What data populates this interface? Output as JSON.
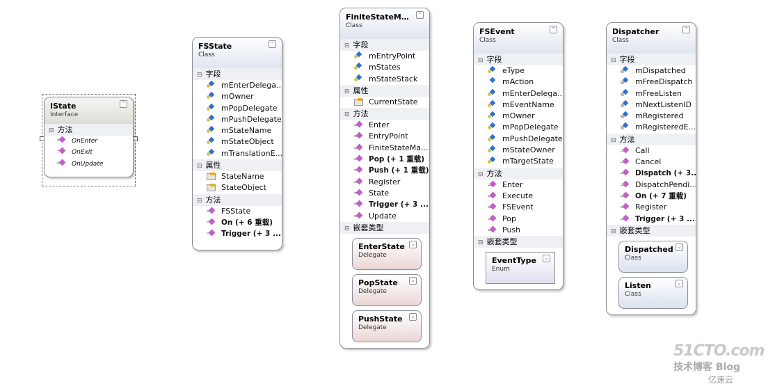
{
  "classes": [
    {
      "id": "istate",
      "title": "IState",
      "subtitle": "Interface",
      "sections": [
        {
          "label": "方法",
          "items": [
            {
              "text": "OnEnter",
              "icon": "method",
              "italic": true
            },
            {
              "text": "OnExit",
              "icon": "method",
              "italic": true
            },
            {
              "text": "OnUpdate",
              "icon": "method",
              "italic": true
            }
          ]
        }
      ]
    },
    {
      "id": "fsstate",
      "title": "FSState",
      "subtitle": "Class",
      "sections": [
        {
          "label": "字段",
          "items": [
            {
              "text": "mEnterDelega...",
              "icon": "field"
            },
            {
              "text": "mOwner",
              "icon": "field"
            },
            {
              "text": "mPopDelegate",
              "icon": "field"
            },
            {
              "text": "mPushDelegate",
              "icon": "field"
            },
            {
              "text": "mStateName",
              "icon": "field"
            },
            {
              "text": "mStateObject",
              "icon": "field"
            },
            {
              "text": "mTranslationE...",
              "icon": "field"
            }
          ]
        },
        {
          "label": "属性",
          "items": [
            {
              "text": "StateName",
              "icon": "prop"
            },
            {
              "text": "StateObject",
              "icon": "prop"
            }
          ]
        },
        {
          "label": "方法",
          "items": [
            {
              "text": "FSState",
              "icon": "method"
            },
            {
              "text": "On (+ 6 重载)",
              "icon": "method",
              "bold": true
            },
            {
              "text": "Trigger (+ 3 ...",
              "icon": "method",
              "bold": true
            }
          ]
        }
      ]
    },
    {
      "id": "fsm",
      "title": "FiniteStateMac...",
      "subtitle": "Class",
      "sections": [
        {
          "label": "字段",
          "items": [
            {
              "text": "mEntryPoint",
              "icon": "field"
            },
            {
              "text": "mStates",
              "icon": "field"
            },
            {
              "text": "mStateStack",
              "icon": "field"
            }
          ]
        },
        {
          "label": "属性",
          "items": [
            {
              "text": "CurrentState",
              "icon": "prop"
            }
          ]
        },
        {
          "label": "方法",
          "items": [
            {
              "text": "Enter",
              "icon": "method"
            },
            {
              "text": "EntryPoint",
              "icon": "method"
            },
            {
              "text": "FiniteStateMa...",
              "icon": "method"
            },
            {
              "text": "Pop (+ 1 重载)",
              "icon": "method",
              "bold": true
            },
            {
              "text": "Push (+ 1 重载)",
              "icon": "method",
              "bold": true
            },
            {
              "text": "Register",
              "icon": "method"
            },
            {
              "text": "State",
              "icon": "method"
            },
            {
              "text": "Trigger (+ 3 ...",
              "icon": "method",
              "bold": true
            },
            {
              "text": "Update",
              "icon": "method"
            }
          ]
        },
        {
          "label": "嵌套类型",
          "nested": [
            {
              "title": "EnterState",
              "subtitle": "Delegate",
              "kind": "delegate"
            },
            {
              "title": "PopState",
              "subtitle": "Delegate",
              "kind": "delegate"
            },
            {
              "title": "PushState",
              "subtitle": "Delegate",
              "kind": "delegate"
            }
          ]
        }
      ]
    },
    {
      "id": "fsevent",
      "title": "FSEvent",
      "subtitle": "Class",
      "sections": [
        {
          "label": "字段",
          "items": [
            {
              "text": "eType",
              "icon": "field"
            },
            {
              "text": "mAction",
              "icon": "field pub"
            },
            {
              "text": "mEnterDelega...",
              "icon": "field"
            },
            {
              "text": "mEventName",
              "icon": "field"
            },
            {
              "text": "mOwner",
              "icon": "field"
            },
            {
              "text": "mPopDelegate",
              "icon": "field"
            },
            {
              "text": "mPushDelegate",
              "icon": "field"
            },
            {
              "text": "mStateOwner",
              "icon": "field"
            },
            {
              "text": "mTargetState",
              "icon": "field"
            }
          ]
        },
        {
          "label": "方法",
          "items": [
            {
              "text": "Enter",
              "icon": "method"
            },
            {
              "text": "Execute",
              "icon": "method"
            },
            {
              "text": "FSEvent",
              "icon": "method"
            },
            {
              "text": "Pop",
              "icon": "method"
            },
            {
              "text": "Push",
              "icon": "method"
            }
          ]
        },
        {
          "label": "嵌套类型",
          "nested": [
            {
              "title": "EventType",
              "subtitle": "Enum",
              "kind": "enum"
            }
          ]
        }
      ]
    },
    {
      "id": "dispatcher",
      "title": "Dispatcher",
      "subtitle": "Class",
      "sections": [
        {
          "label": "字段",
          "items": [
            {
              "text": "mDispatched",
              "icon": "field prot"
            },
            {
              "text": "mFreeDispatch",
              "icon": "field prot"
            },
            {
              "text": "mFreeListen",
              "icon": "field prot"
            },
            {
              "text": "mNextListenID",
              "icon": "field prot"
            },
            {
              "text": "mRegistered",
              "icon": "field prot"
            },
            {
              "text": "mRegisteredE...",
              "icon": "field prot"
            }
          ]
        },
        {
          "label": "方法",
          "items": [
            {
              "text": "Call",
              "icon": "method"
            },
            {
              "text": "Cancel",
              "icon": "method"
            },
            {
              "text": "Dispatch (+ 3...",
              "icon": "method",
              "bold": true
            },
            {
              "text": "DispatchPendi...",
              "icon": "method"
            },
            {
              "text": "On (+ 7 重载)",
              "icon": "method",
              "bold": true
            },
            {
              "text": "Register",
              "icon": "method"
            },
            {
              "text": "Trigger (+ 3 ...",
              "icon": "method",
              "bold": true
            }
          ]
        },
        {
          "label": "嵌套类型",
          "nested": [
            {
              "title": "Dispatched",
              "subtitle": "Class",
              "kind": "class"
            },
            {
              "title": "Listen",
              "subtitle": "Class",
              "kind": "class"
            }
          ]
        }
      ]
    }
  ],
  "watermark": {
    "line1": "51CTO.com",
    "line2": "技术博客  Blog",
    "line3": "亿速云"
  }
}
